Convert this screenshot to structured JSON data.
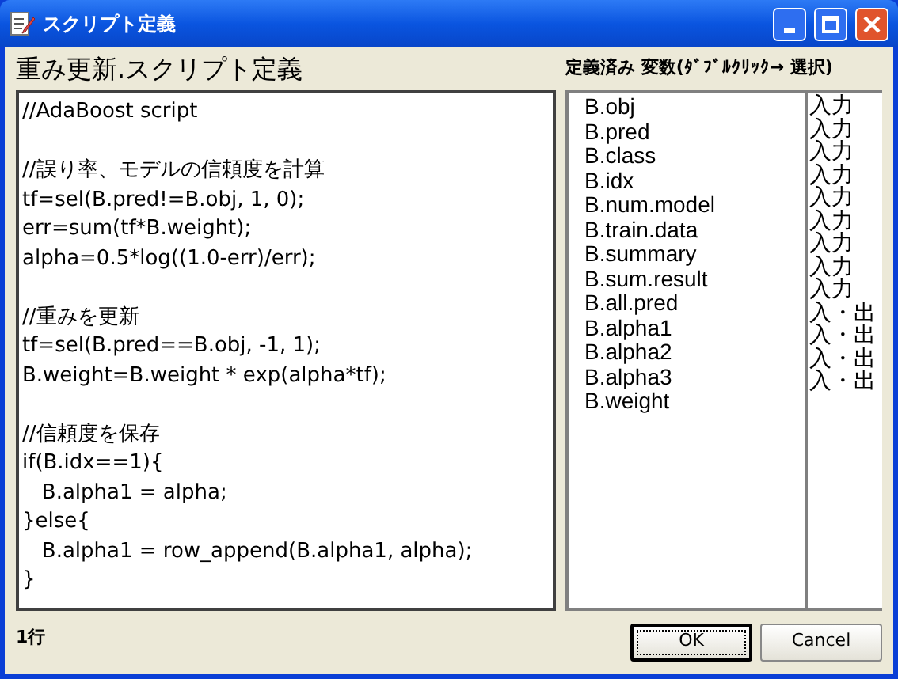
{
  "window": {
    "title": "スクリプト定義"
  },
  "editor": {
    "heading": "重み更新.スクリプト定義",
    "blocks": [
      [
        "//AdaBoost script"
      ],
      [
        "//誤り率、モデルの信頼度を計算",
        "tf=sel(B.pred!=B.obj, 1, 0);",
        "err=sum(tf*B.weight);",
        "alpha=0.5*log((1.0-err)/err);"
      ],
      [
        "//重みを更新",
        "tf=sel(B.pred==B.obj, -1, 1);",
        "B.weight=B.weight * exp(alpha*tf);"
      ],
      [
        "//信頼度を保存",
        "if(B.idx==1){",
        "   B.alpha1 = alpha;",
        "}else{",
        "   B.alpha1 = row_append(B.alpha1, alpha);",
        "}"
      ]
    ]
  },
  "variables": {
    "heading": "定義済み 変数(ﾀﾞﾌﾞﾙｸﾘｯｸ→ 選択)",
    "items": [
      {
        "name": "B.obj",
        "io": "入力"
      },
      {
        "name": "B.pred",
        "io": "入力"
      },
      {
        "name": "B.class",
        "io": "入力"
      },
      {
        "name": "B.idx",
        "io": "入力"
      },
      {
        "name": "B.num.model",
        "io": "入力"
      },
      {
        "name": "B.train.data",
        "io": "入力"
      },
      {
        "name": "B.summary",
        "io": "入力"
      },
      {
        "name": "B.sum.result",
        "io": "入力"
      },
      {
        "name": "B.all.pred",
        "io": "入力"
      },
      {
        "name": "B.alpha1",
        "io": "入・出"
      },
      {
        "name": "B.alpha2",
        "io": "入・出"
      },
      {
        "name": "B.alpha3",
        "io": "入・出"
      },
      {
        "name": "B.weight",
        "io": "入・出"
      }
    ]
  },
  "status": "1行",
  "buttons": [
    {
      "label": "OK",
      "default": true
    },
    {
      "label": "Cancel",
      "default": false
    }
  ]
}
